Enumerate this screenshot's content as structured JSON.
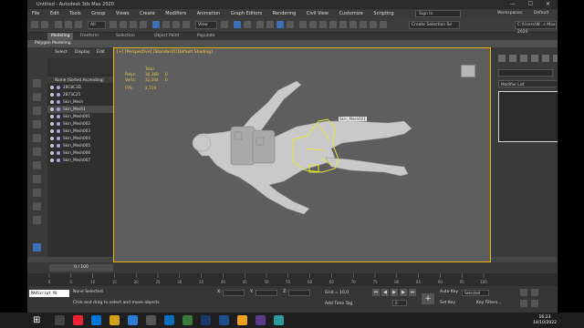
{
  "app": {
    "title": "Untitled - Autodesk 3ds Max 2020",
    "window_controls": "—  ☐  ✕"
  },
  "menu": {
    "items": [
      "File",
      "Edit",
      "Tools",
      "Group",
      "Views",
      "Create",
      "Modifiers",
      "Animation",
      "Graph Editors",
      "Rendering",
      "Civil View",
      "Customize",
      "Scripting"
    ],
    "sign_in": "Sign In",
    "workspaces_label": "Workspaces:",
    "workspaces_value": "Default"
  },
  "toolbar": {
    "filter_value": "All",
    "view_value": "View",
    "selection_set_placeholder": "Create Selection Se",
    "path_value": "C:\\Users\\W...s Max 2020"
  },
  "ribbon": {
    "tabs": [
      "Modeling",
      "Freeform",
      "Selection",
      "Object Paint",
      "Populate"
    ],
    "sub_label": "Polygon Modeling"
  },
  "scene_explorer": {
    "tabs": [
      "Select",
      "Display",
      "Edit"
    ],
    "column_header": "Name (Sorted Ascending)",
    "items": [
      "2BC8C3D",
      "2B73C25",
      "Skin_Mesh",
      "Skin_Mesh1",
      "Skin_Mesh001",
      "Skin_Mesh002",
      "Skin_Mesh003",
      "Skin_Mesh004",
      "Skin_Mesh005",
      "Skin_Mesh006",
      "Skin_Mesh007"
    ],
    "selected_index": 3
  },
  "viewport": {
    "label": "[+] [Perspective] [Standard] [Default Shading]",
    "stats_total": "Total",
    "polys_label": "Polys:",
    "polys_total": "30,369",
    "polys_sel": "0",
    "verts_label": "Verts:",
    "verts_total": "32,564",
    "verts_sel": "0",
    "fps_label": "FPS:",
    "fps_value": "2,719",
    "object_label": "Skin_Mesh001"
  },
  "command_panel": {
    "modifier_list": "Modifier List"
  },
  "timeline": {
    "frame_slider": "0 / 100",
    "ticks": [
      "0",
      "5",
      "10",
      "15",
      "20",
      "25",
      "30",
      "35",
      "40",
      "45",
      "50",
      "55",
      "60",
      "65",
      "70",
      "75",
      "80",
      "85",
      "90",
      "95",
      "100"
    ]
  },
  "status": {
    "maxscript": "MAXScript Mi",
    "selection_text": "None Selected",
    "prompt": "Click and drag to select and move objects",
    "x_label": "X:",
    "y_label": "Y:",
    "z_label": "Z:",
    "grid": "Grid = 10,0",
    "add_time_tag": "Add Time Tag",
    "auto_key": "Auto Key",
    "set_key": "Set Key",
    "key_mode": "Selected",
    "key_filters": "Key Filters...",
    "frame_value": "0"
  },
  "taskbar": {
    "time": "16:23",
    "date": "14/10/2022"
  },
  "colors": {
    "viewport_border": "#f0b400",
    "selection_outline": "#e6e63a",
    "stats_text": "#e8c84a",
    "accent_blue": "#3b6fb6"
  }
}
